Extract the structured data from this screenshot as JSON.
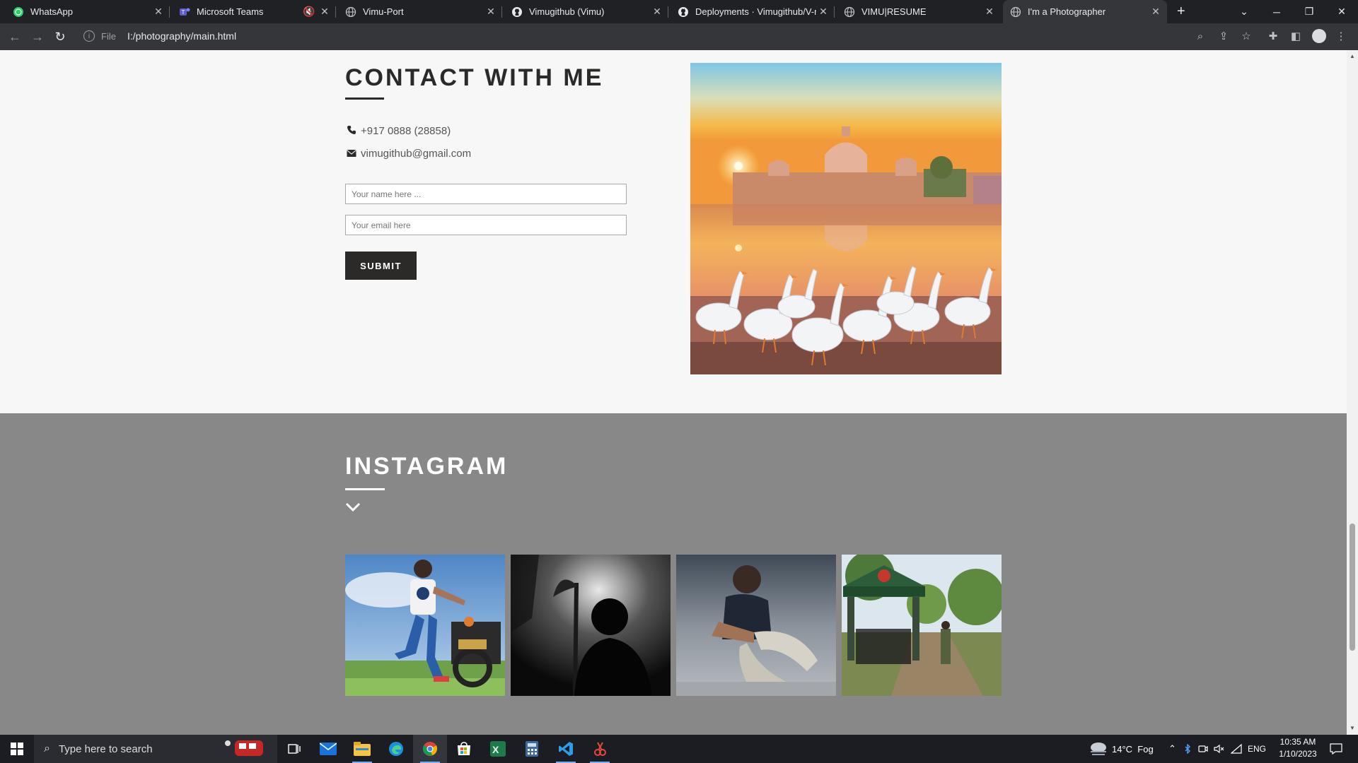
{
  "browser": {
    "tabs": [
      {
        "title": "WhatsApp",
        "icon": "whatsapp-icon"
      },
      {
        "title": "Microsoft Teams",
        "icon": "teams-icon",
        "muted": true
      },
      {
        "title": "Vimu-Port",
        "icon": "globe-icon"
      },
      {
        "title": "Vimugithub (Vimu)",
        "icon": "github-icon"
      },
      {
        "title": "Deployments · Vimugithub/V-re",
        "icon": "github-icon"
      },
      {
        "title": "VIMU|RESUME",
        "icon": "globe-icon"
      },
      {
        "title": "I'm a Photographer",
        "icon": "globe-icon",
        "active": true
      }
    ],
    "url_scheme_label": "File",
    "url": "I:/photography/main.html"
  },
  "contact": {
    "title": "CONTACT WITH ME",
    "phone": "+917 0888 (28858)",
    "email": "vimugithub@gmail.com",
    "name_placeholder": "Your name here ...",
    "email_placeholder": "Your email here",
    "submit_label": "SUBMIT"
  },
  "instagram": {
    "title": "INSTAGRAM",
    "photos": [
      {
        "subject": "man with motorcycle"
      },
      {
        "subject": "silhouette in fog"
      },
      {
        "subject": "man sitting on rock"
      },
      {
        "subject": "man at forest gate"
      }
    ]
  },
  "taskbar": {
    "search_placeholder": "Type here to search",
    "weather": "14°C  Fog",
    "language": "ENG",
    "time": "10:35 AM",
    "date": "1/10/2023"
  },
  "colors": {
    "dark_accent": "#2b2a29",
    "insta_bg": "#888888",
    "page_bg": "#f7f7f7",
    "chrome_dark": "#202124"
  }
}
